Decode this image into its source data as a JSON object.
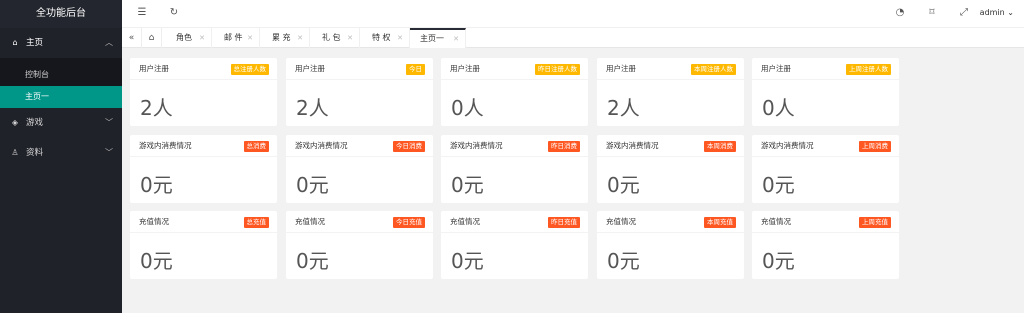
{
  "app": {
    "title": "全功能后台"
  },
  "sidebar": {
    "home": {
      "label": "主页",
      "icon": "home-icon"
    },
    "home_items": [
      {
        "label": "控制台"
      },
      {
        "label": "主页一"
      }
    ],
    "game": {
      "label": "游戏",
      "icon": "diamond-icon"
    },
    "data": {
      "label": "资料",
      "icon": "user-icon"
    }
  },
  "header": {
    "user": "admin"
  },
  "tabs": [
    {
      "label": "角色"
    },
    {
      "label": "邮 件"
    },
    {
      "label": "累 充"
    },
    {
      "label": "礼 包"
    },
    {
      "label": "特 权"
    },
    {
      "label": "主页一"
    }
  ],
  "cards": [
    {
      "title": "用户注册",
      "badge": "总注册人数",
      "value": "2人",
      "color": "#ffb800"
    },
    {
      "title": "用户注册",
      "badge": "今日",
      "value": "2人",
      "color": "#ffb800"
    },
    {
      "title": "用户注册",
      "badge": "昨日注册人数",
      "value": "0人",
      "color": "#ffb800"
    },
    {
      "title": "用户注册",
      "badge": "本周注册人数",
      "value": "2人",
      "color": "#ffb800"
    },
    {
      "title": "用户注册",
      "badge": "上周注册人数",
      "value": "0人",
      "color": "#ffb800"
    },
    {
      "title": "游戏内消费情况",
      "badge": "总消费",
      "value": "0元",
      "color": "#ff5722"
    },
    {
      "title": "游戏内消费情况",
      "badge": "今日消费",
      "value": "0元",
      "color": "#ff5722"
    },
    {
      "title": "游戏内消费情况",
      "badge": "昨日消费",
      "value": "0元",
      "color": "#ff5722"
    },
    {
      "title": "游戏内消费情况",
      "badge": "本周消费",
      "value": "0元",
      "color": "#ff5722"
    },
    {
      "title": "游戏内消费情况",
      "badge": "上周消费",
      "value": "0元",
      "color": "#ff5722"
    },
    {
      "title": "充值情况",
      "badge": "总充值",
      "value": "0元",
      "color": "#ff5722"
    },
    {
      "title": "充值情况",
      "badge": "今日充值",
      "value": "0元",
      "color": "#ff5722"
    },
    {
      "title": "充值情况",
      "badge": "昨日充值",
      "value": "0元",
      "color": "#ff5722"
    },
    {
      "title": "充值情况",
      "badge": "本周充值",
      "value": "0元",
      "color": "#ff5722"
    },
    {
      "title": "充值情况",
      "badge": "上周充值",
      "value": "0元",
      "color": "#ff5722"
    }
  ]
}
